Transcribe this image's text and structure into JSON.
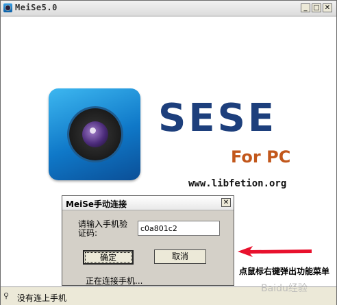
{
  "window": {
    "title": "MeiSe5.0",
    "min_glyph": "_",
    "max_glyph": "□",
    "close_glyph": "✕"
  },
  "logo": {
    "brand": "SESE",
    "sub": "For PC",
    "url": "www.libfetion.org"
  },
  "dialog": {
    "title": "MeiSe手动连接",
    "close_glyph": "✕",
    "label": "请输入手机验证码:",
    "code_value": "c0a801c2",
    "ok_label": "确定",
    "cancel_label": "取消",
    "status": "正在连接手机..."
  },
  "statusbar": {
    "text": "没有连上手机"
  },
  "annotation": {
    "hint": "点鼠标右键弹出功能菜单",
    "arrow_color": "#e8112d"
  },
  "watermark": {
    "text": "Baidu经验"
  }
}
